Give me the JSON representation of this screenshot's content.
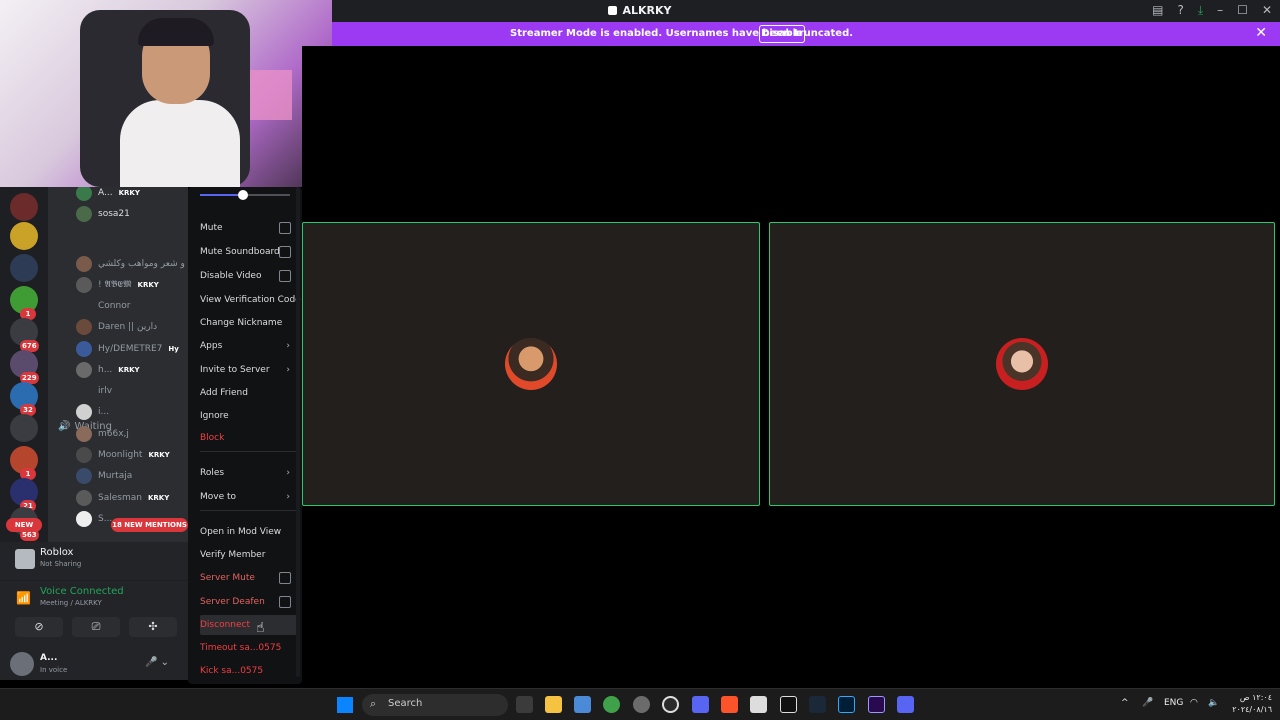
{
  "window": {
    "title": "ALKRKY"
  },
  "banner": {
    "message": "Streamer Mode is enabled. Usernames have been truncated.",
    "button": "Disable",
    "close": "✕"
  },
  "servers": [
    {
      "badge": "",
      "color": "#6b2b2b"
    },
    {
      "badge": "",
      "color": "#c9a227"
    },
    {
      "badge": "",
      "color": "#2d3b55"
    },
    {
      "badge": "1",
      "color": "#3f9c35"
    },
    {
      "badge": "676",
      "color": "#3a3c42"
    },
    {
      "badge": "229",
      "color": "#5a4a6b"
    },
    {
      "badge": "32",
      "color": "#2b6cb0"
    },
    {
      "badge": "",
      "color": "#3a3c42"
    },
    {
      "badge": "1",
      "color": "#b5462d"
    },
    {
      "badge": "21",
      "color": "#2a2f6e"
    },
    {
      "badge": "563",
      "color": "#3a3c42"
    }
  ],
  "server_rail": {
    "new_label": "NEW"
  },
  "members": [
    {
      "name": "A...",
      "tag": "KRKY"
    },
    {
      "name": "sosa21",
      "tag": ""
    },
    {
      "name": "عجاب و شعر ومواهب وكلشي !",
      "tag": ""
    },
    {
      "name": "! 𝕬𝕭𝕰𝕸",
      "tag": "KRKY"
    },
    {
      "name": "Connor",
      "tag": ""
    },
    {
      "name": "Daren || دارين",
      "tag": ""
    },
    {
      "name": "Hy/DEMETRE7",
      "tag": "Hy"
    },
    {
      "name": "h...",
      "tag": "KRKY"
    },
    {
      "name": "irlv",
      "tag": ""
    },
    {
      "name": "i...",
      "tag": ""
    },
    {
      "name": "m66x,j",
      "tag": ""
    },
    {
      "name": "Moonlight",
      "tag": "KRKY"
    },
    {
      "name": "Murtaja",
      "tag": ""
    },
    {
      "name": "Salesman",
      "tag": "KRKY"
    },
    {
      "name": "S...",
      "tag": ""
    }
  ],
  "channel": {
    "name": "Waiting"
  },
  "mentions": "18 NEW MENTIONS",
  "activity": {
    "game": "Roblox",
    "status": "Not Sharing"
  },
  "voice": {
    "status": "Voice Connected",
    "location": "Meeting / ALKRKY"
  },
  "user": {
    "name": "A...",
    "status": "In voice"
  },
  "context_menu": {
    "volume": 0.48,
    "items": [
      {
        "label": "Mute",
        "kind": "checkbox"
      },
      {
        "label": "Mute Soundboard",
        "kind": "checkbox"
      },
      {
        "label": "Disable Video",
        "kind": "checkbox"
      },
      {
        "label": "View Verification Code",
        "kind": "plain"
      },
      {
        "label": "Change Nickname",
        "kind": "plain"
      },
      {
        "label": "Apps",
        "kind": "submenu"
      },
      {
        "label": "Invite to Server",
        "kind": "submenu"
      },
      {
        "label": "Add Friend",
        "kind": "plain"
      },
      {
        "label": "Ignore",
        "kind": "plain"
      },
      {
        "label": "Block",
        "kind": "danger"
      },
      {
        "label": "Roles",
        "kind": "submenu"
      },
      {
        "label": "Move to",
        "kind": "submenu"
      },
      {
        "label": "Open in Mod View",
        "kind": "plain"
      },
      {
        "label": "Verify Member",
        "kind": "plain"
      },
      {
        "label": "Server Mute",
        "kind": "danger-checkbox"
      },
      {
        "label": "Server Deafen",
        "kind": "danger-checkbox"
      },
      {
        "label": "Disconnect",
        "kind": "danger"
      },
      {
        "label": "Timeout sa...0575",
        "kind": "danger"
      },
      {
        "label": "Kick sa...0575",
        "kind": "danger"
      }
    ]
  },
  "taskbar": {
    "search_label": "Search",
    "lang": "ENG",
    "time": "١٢:٠٤ ص",
    "date": "٢٠٢٤/٠٨/١٦"
  }
}
